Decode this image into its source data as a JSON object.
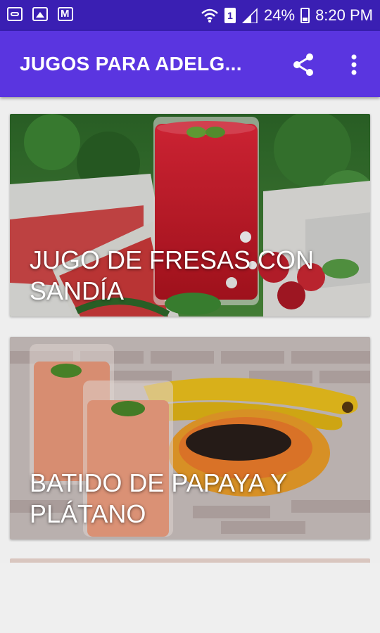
{
  "statusbar": {
    "battery": "24%",
    "time": "8:20 PM",
    "sim_slot": "1"
  },
  "appbar": {
    "title": "JUGOS PARA ADELG...",
    "share_icon": "share-icon",
    "more_icon": "more-vert-icon"
  },
  "recipes": [
    {
      "title": "JUGO DE FRESAS CON SANDÍA"
    },
    {
      "title": "BATIDO DE PAPAYA Y PLÁTANO"
    }
  ],
  "colors": {
    "statusbar": "#3a1fb3",
    "appbar": "#5a35e0"
  }
}
